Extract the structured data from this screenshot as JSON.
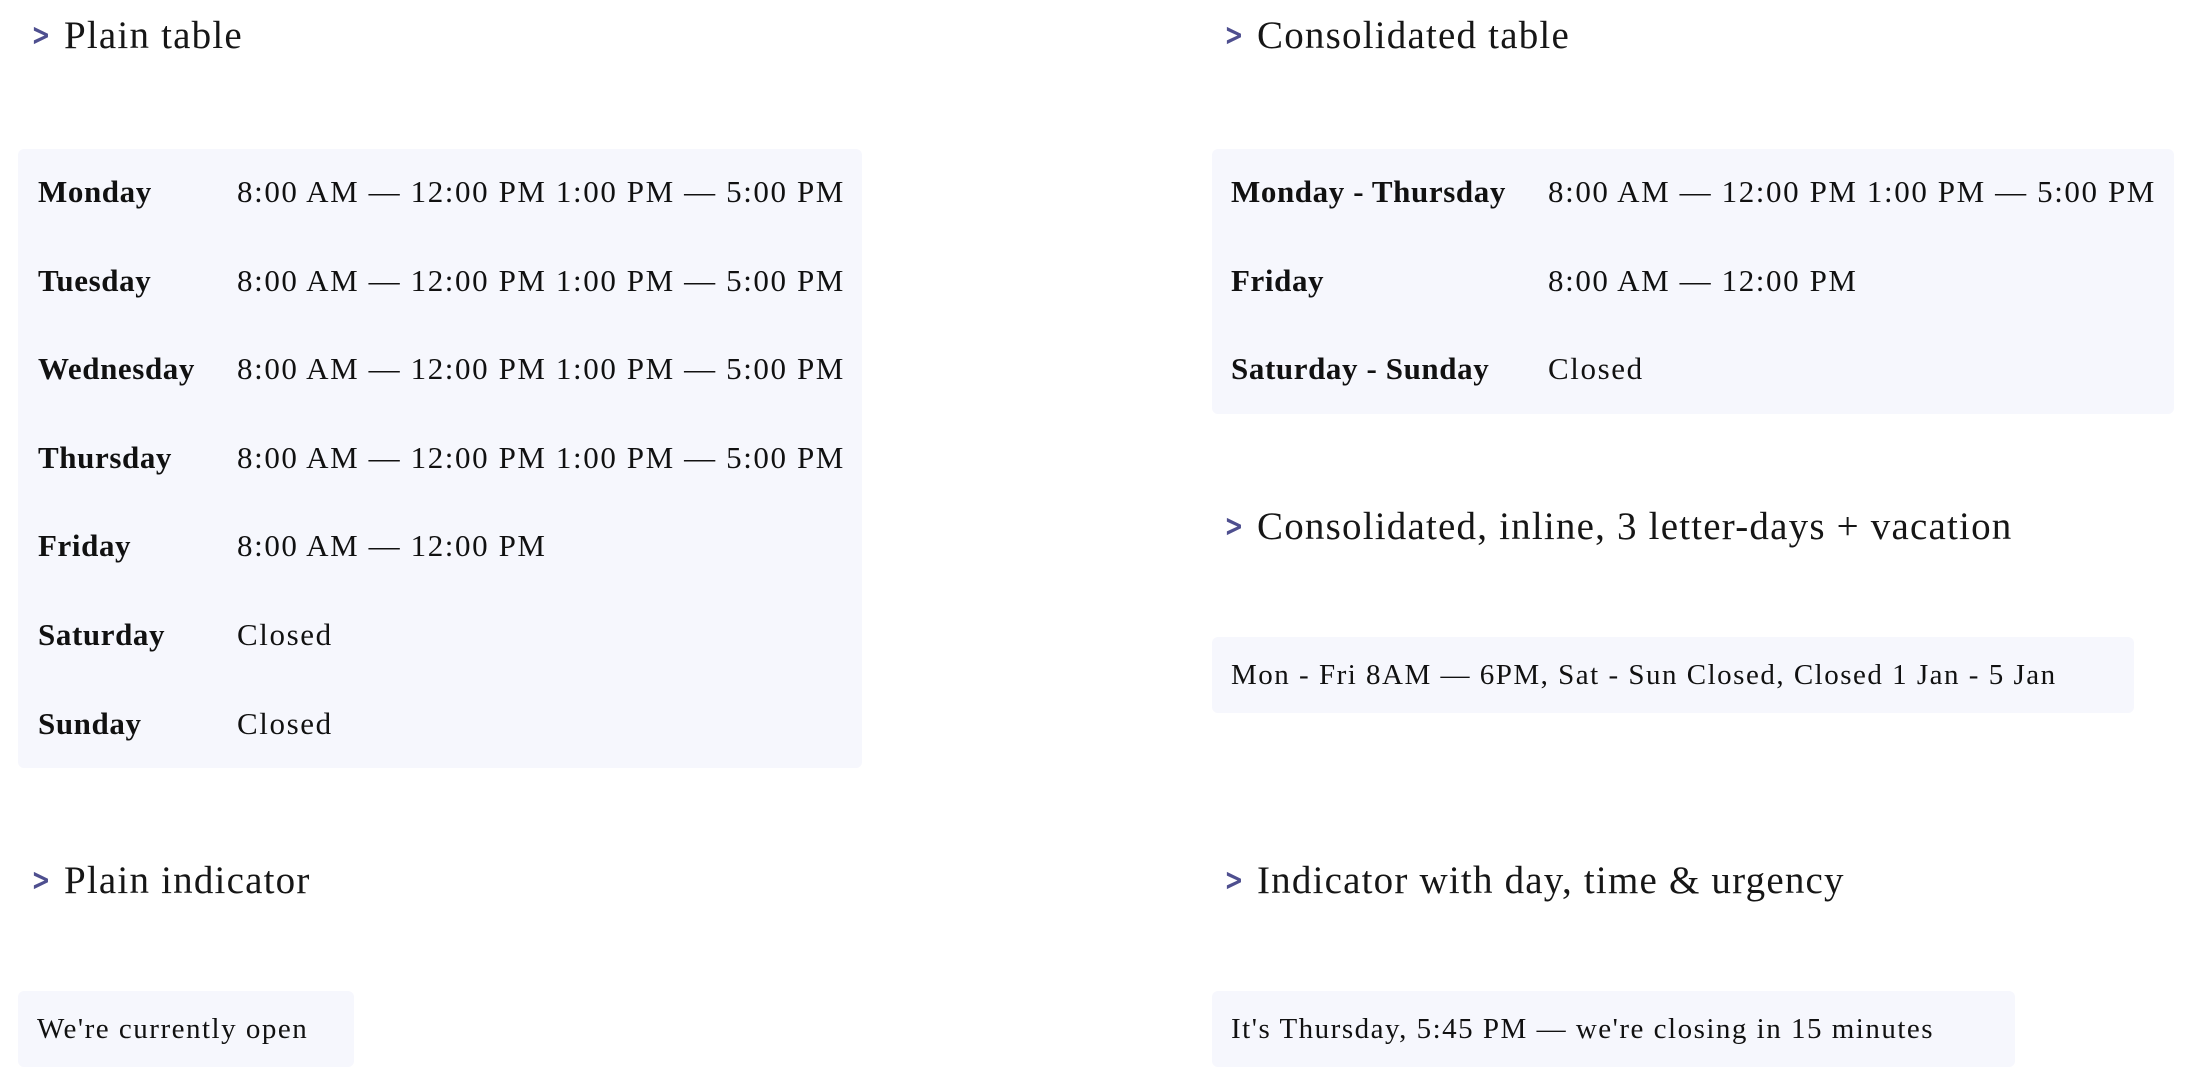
{
  "colors": {
    "accent": "#4e4f8f",
    "box_background": "#f6f7fd",
    "text": "#111111"
  },
  "sections": {
    "plain_table": {
      "title": "Plain table",
      "icon": "chevron-right-icon",
      "rows": [
        {
          "day": "Monday",
          "hours": "8:00 AM — 12:00 PM 1:00 PM — 5:00 PM"
        },
        {
          "day": "Tuesday",
          "hours": "8:00 AM — 12:00 PM 1:00 PM — 5:00 PM"
        },
        {
          "day": "Wednesday",
          "hours": "8:00 AM — 12:00 PM 1:00 PM — 5:00 PM"
        },
        {
          "day": "Thursday",
          "hours": "8:00 AM — 12:00 PM 1:00 PM — 5:00 PM"
        },
        {
          "day": "Friday",
          "hours": "8:00 AM — 12:00 PM"
        },
        {
          "day": "Saturday",
          "hours": "Closed"
        },
        {
          "day": "Sunday",
          "hours": "Closed"
        }
      ]
    },
    "consolidated_table": {
      "title": "Consolidated table",
      "icon": "chevron-right-icon",
      "rows": [
        {
          "day": "Monday - Thursday",
          "hours": "8:00 AM — 12:00 PM 1:00 PM — 5:00 PM"
        },
        {
          "day": "Friday",
          "hours": "8:00 AM — 12:00 PM"
        },
        {
          "day": "Saturday - Sunday",
          "hours": "Closed"
        }
      ]
    },
    "consolidated_inline": {
      "title": "Consolidated, inline, 3 letter-days + vacation",
      "icon": "chevron-right-icon",
      "text": "Mon - Fri 8AM — 6PM, Sat - Sun Closed, Closed 1 Jan - 5 Jan"
    },
    "plain_indicator": {
      "title": "Plain indicator",
      "icon": "chevron-right-icon",
      "text": "We're currently open"
    },
    "indicator_urgency": {
      "title": "Indicator with day, time & urgency",
      "icon": "chevron-right-icon",
      "text": "It's Thursday, 5:45 PM — we're closing in 15 minutes"
    }
  }
}
